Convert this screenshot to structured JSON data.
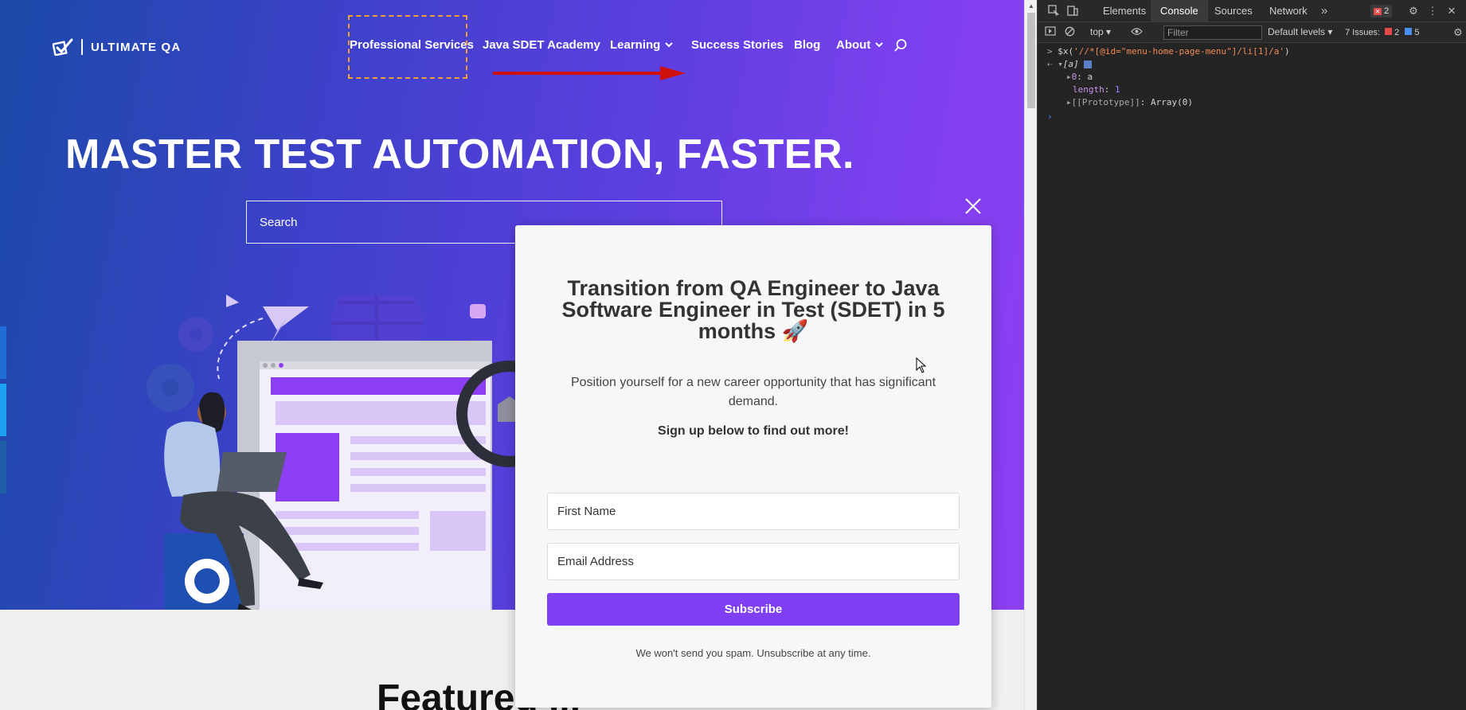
{
  "site": {
    "logo_text": "ULTIMATE QA",
    "nav": [
      {
        "label": "Professional Services",
        "has_caret": false
      },
      {
        "label": "Java SDET Academy",
        "has_caret": false
      },
      {
        "label": "Learning",
        "has_caret": true
      },
      {
        "label": "Success Stories",
        "has_caret": false
      },
      {
        "label": "Blog",
        "has_caret": false
      },
      {
        "label": "About",
        "has_caret": true
      }
    ],
    "hero_title": "MASTER TEST AUTOMATION, FASTER.",
    "search_placeholder": "Search",
    "section_title_partial": "Featured ..."
  },
  "popup": {
    "title": "Transition from QA Engineer to Java Software Engineer in Test (SDET) in 5 months 🚀",
    "description": "Position yourself for a new career opportunity that has significant demand.",
    "cta": "Sign up below to find out more!",
    "first_name_placeholder": "First Name",
    "email_placeholder": "Email Address",
    "subscribe_label": "Subscribe",
    "spam_note": "We won't send you spam. Unsubscribe at any time."
  },
  "devtools": {
    "tabs": [
      "Elements",
      "Console",
      "Sources",
      "Network"
    ],
    "active_tab": "Console",
    "error_count": "2",
    "context": "top",
    "filter_placeholder": "Filter",
    "levels": "Default levels",
    "issues_label": "7 Issues:",
    "issues_errors": "2",
    "issues_info": "5",
    "console": {
      "command_prefix": "$x(",
      "command_string": "'//*[@id=\"menu-home-page-menu\"]/li[1]/a'",
      "command_suffix": ")",
      "result_header": "[a]",
      "item_0_key": "0",
      "item_0_val": "a",
      "length_key": "length",
      "length_val": "1",
      "proto_key": "[[Prototype]]",
      "proto_val": "Array(0)"
    }
  },
  "colors": {
    "accent_purple": "#7f3ff2",
    "highlight_orange": "#f0a030",
    "arrow_red": "#d0100c",
    "devtools_bg": "#242424"
  }
}
